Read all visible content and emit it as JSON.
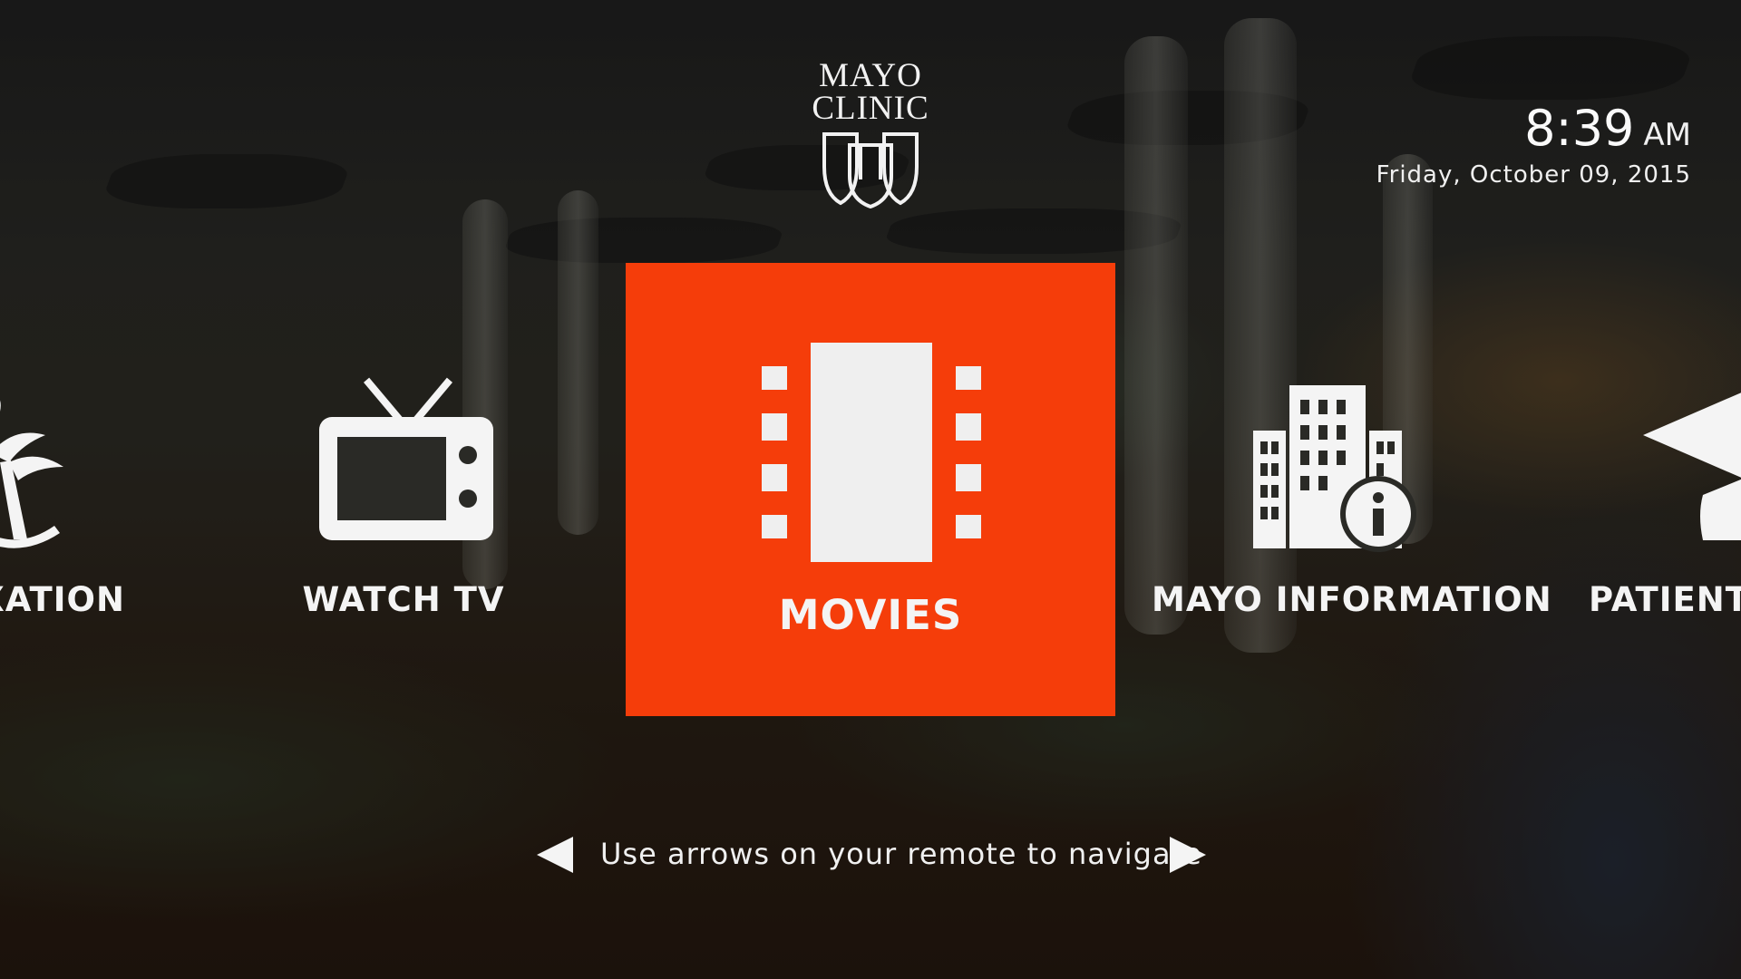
{
  "brand": {
    "logo_line1": "MAYO",
    "logo_line2": "CLINIC",
    "accent_color": "#f53d0a"
  },
  "clock": {
    "time": "8:39",
    "ampm": "AM",
    "date": "Friday, October 09, 2015"
  },
  "menu": {
    "selected": "movies",
    "items": [
      {
        "id": "relaxation",
        "label": "LAXATION",
        "icon": "palm-tree-music-icon"
      },
      {
        "id": "watch-tv",
        "label": "WATCH TV",
        "icon": "tv-icon"
      },
      {
        "id": "movies",
        "label": "MOVIES",
        "icon": "film-strip-icon"
      },
      {
        "id": "mayo-information",
        "label": "MAYO INFORMATION",
        "icon": "building-info-icon"
      },
      {
        "id": "patient",
        "label": "PATIENT E",
        "icon": "graduation-cap-icon"
      }
    ]
  },
  "navigation": {
    "hint": "Use arrows on your remote to navigate",
    "left_icon": "arrow-left-icon",
    "right_icon": "arrow-right-icon"
  }
}
